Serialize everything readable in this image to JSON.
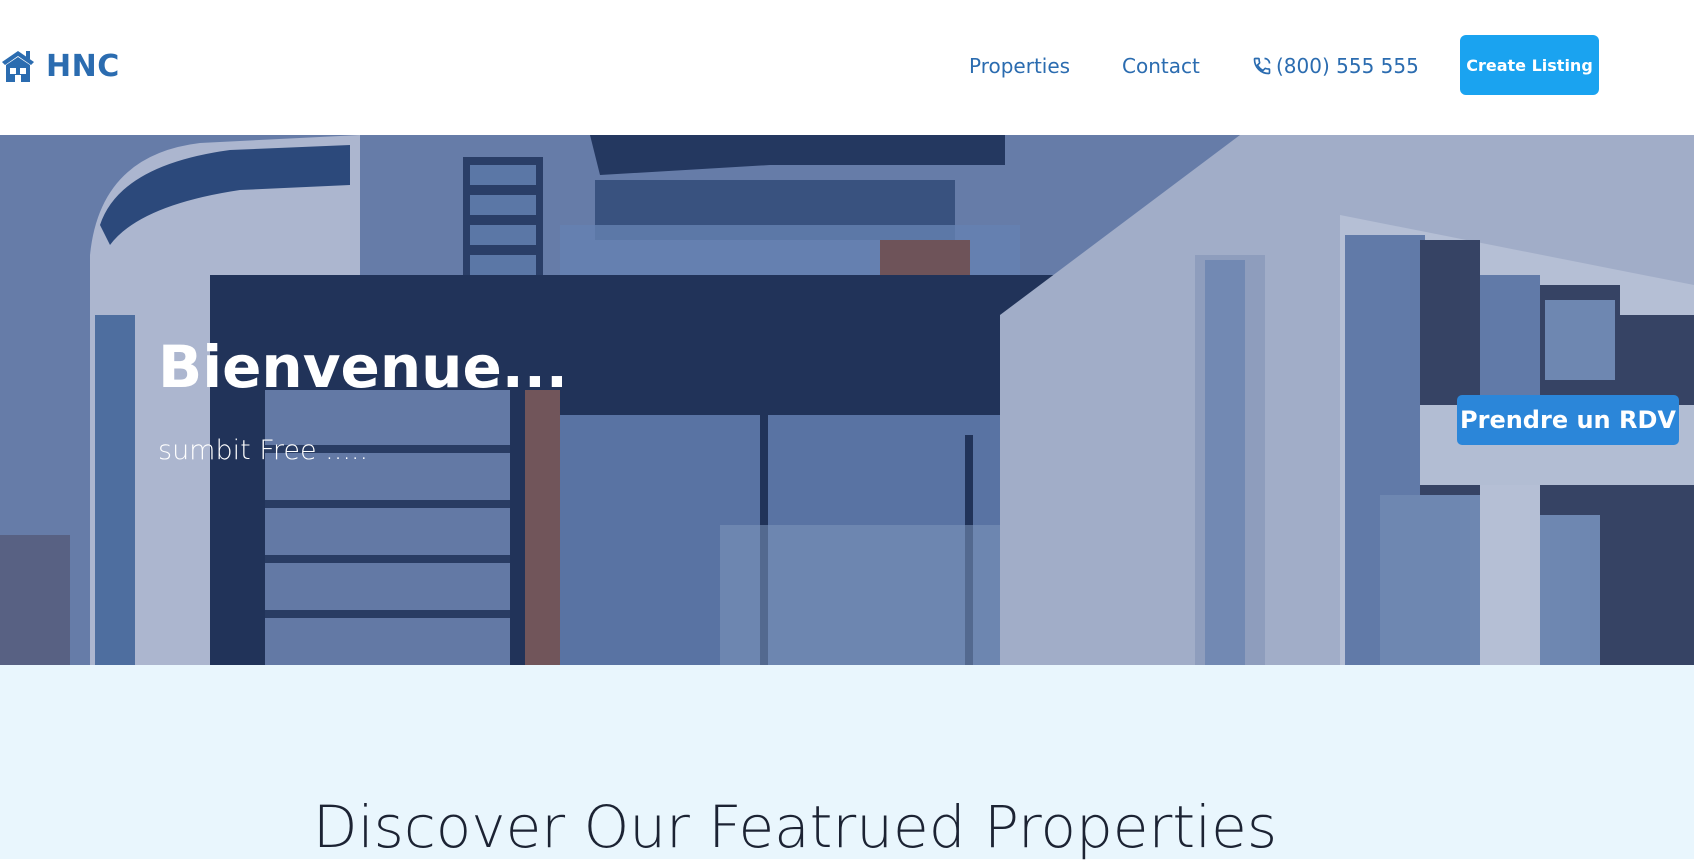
{
  "header": {
    "brand": {
      "name": "HNC",
      "icon": "house-icon"
    },
    "nav": {
      "properties_label": "Properties",
      "contact_label": "Contact",
      "phone": {
        "icon": "phone-icon",
        "number": "(800) 555 555"
      }
    },
    "create_listing_label": "Create Listing"
  },
  "hero": {
    "title": "Bienvenue...",
    "subtitle": "sumbit Free .....",
    "cta_label": "Prendre un RDV"
  },
  "featured": {
    "title": "Discover Our Featrued Properties"
  },
  "colors": {
    "brand_blue": "#2b6cb0",
    "primary_button": "#1aa3f0",
    "hero_button": "#2b86d9",
    "featured_background": "#e9f6fd"
  }
}
